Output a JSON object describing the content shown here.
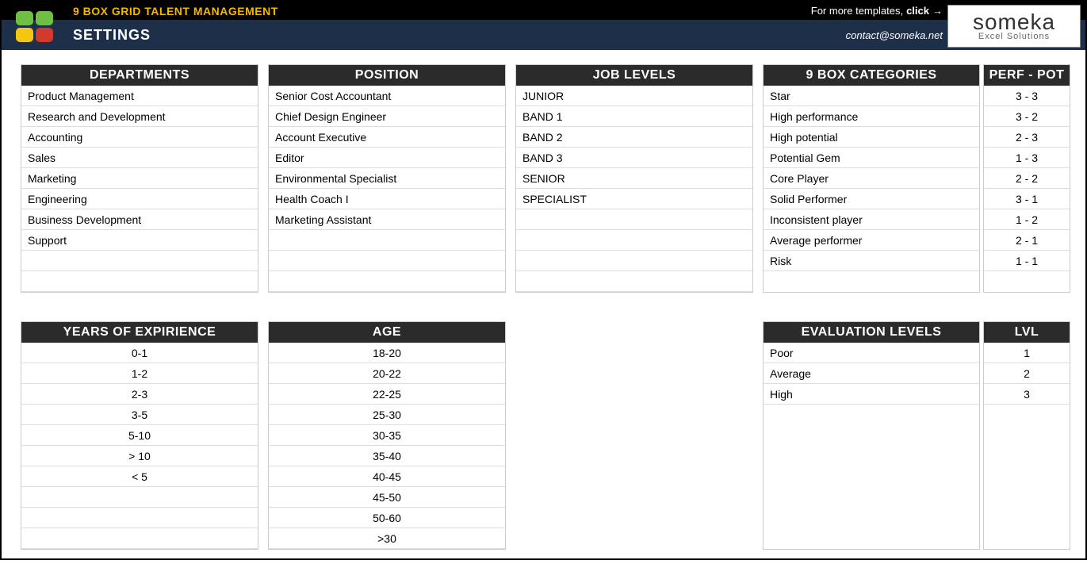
{
  "header": {
    "title": "9 BOX GRID TALENT MANAGEMENT",
    "more_prefix": "For more templates, ",
    "more_bold": "click",
    "subtitle": "SETTINGS",
    "contact": "contact@someka.net",
    "logo_brand": "someka",
    "logo_sub": "Excel Solutions"
  },
  "departments": {
    "header": "DEPARTMENTS",
    "items": [
      "Product Management",
      "Research and Development",
      "Accounting",
      "Sales",
      "Marketing",
      "Engineering",
      "Business Development",
      "Support",
      "",
      ""
    ]
  },
  "position": {
    "header": "POSITION",
    "items": [
      "Senior Cost Accountant",
      "Chief Design Engineer",
      "Account Executive",
      "Editor",
      "Environmental Specialist",
      "Health Coach I",
      "Marketing Assistant",
      "",
      "",
      ""
    ]
  },
  "joblevels": {
    "header": "JOB LEVELS",
    "items": [
      "JUNIOR",
      "BAND 1",
      "BAND 2",
      "BAND 3",
      "SENIOR",
      "SPECIALIST",
      "",
      "",
      "",
      ""
    ]
  },
  "categories": {
    "header": "9 BOX CATEGORIES",
    "perf_header": "PERF - POT",
    "items": [
      "Star",
      "High performance",
      "High potential",
      "Potential Gem",
      "Core Player",
      "Solid Performer",
      "Inconsistent player",
      "Average performer",
      "Risk"
    ],
    "perf": [
      "3 - 3",
      "3 - 2",
      "2 - 3",
      "1 - 3",
      "2 - 2",
      "3 - 1",
      "1 - 2",
      "2 - 1",
      "1 - 1"
    ]
  },
  "experience": {
    "header": "YEARS OF EXPIRIENCE",
    "items": [
      "0-1",
      "1-2",
      "2-3",
      "3-5",
      "5-10",
      "> 10",
      "< 5",
      "",
      "",
      ""
    ]
  },
  "age": {
    "header": "AGE",
    "items": [
      "18-20",
      "20-22",
      "22-25",
      "25-30",
      "30-35",
      "35-40",
      "40-45",
      "45-50",
      "50-60",
      ">30"
    ]
  },
  "evaluation": {
    "header": "EVALUATION LEVELS",
    "lvl_header": "LVL",
    "items": [
      "Poor",
      "Average",
      "High"
    ],
    "lvls": [
      "1",
      "2",
      "3"
    ]
  }
}
